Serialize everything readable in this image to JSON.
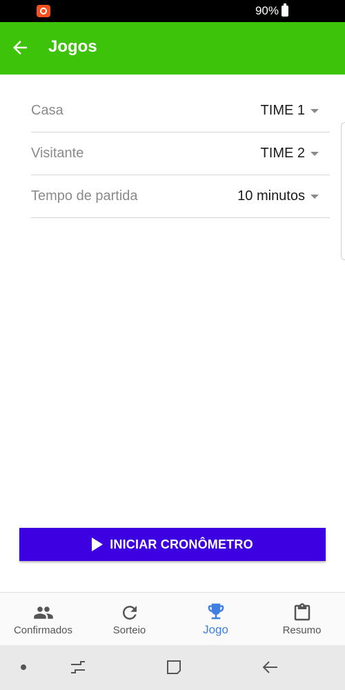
{
  "status_bar": {
    "battery_text": "90%",
    "app_icon": "notification-app-icon"
  },
  "app_bar": {
    "title": "Jogos",
    "back_icon": "arrow-left-icon",
    "color": "#3cc30a"
  },
  "form": {
    "rows": [
      {
        "label": "Casa",
        "value": "TIME 1"
      },
      {
        "label": "Visitante",
        "value": "TIME 2"
      },
      {
        "label": "Tempo de partida",
        "value": "10 minutos"
      }
    ]
  },
  "start_button": {
    "label": "INICIAR CRONÔMETRO",
    "icon": "play-icon",
    "color": "#3d00e0"
  },
  "bottom_nav": {
    "items": [
      {
        "label": "Confirmados",
        "icon": "people-icon"
      },
      {
        "label": "Sorteio",
        "icon": "refresh-icon"
      },
      {
        "label": "Jogo",
        "icon": "trophy-icon",
        "active": true
      },
      {
        "label": "Resumo",
        "icon": "clipboard-icon"
      }
    ],
    "active_color": "#3f7fe0"
  },
  "system_nav": {
    "icons": [
      "dot-icon",
      "recent-apps-icon",
      "home-icon",
      "back-icon"
    ]
  }
}
